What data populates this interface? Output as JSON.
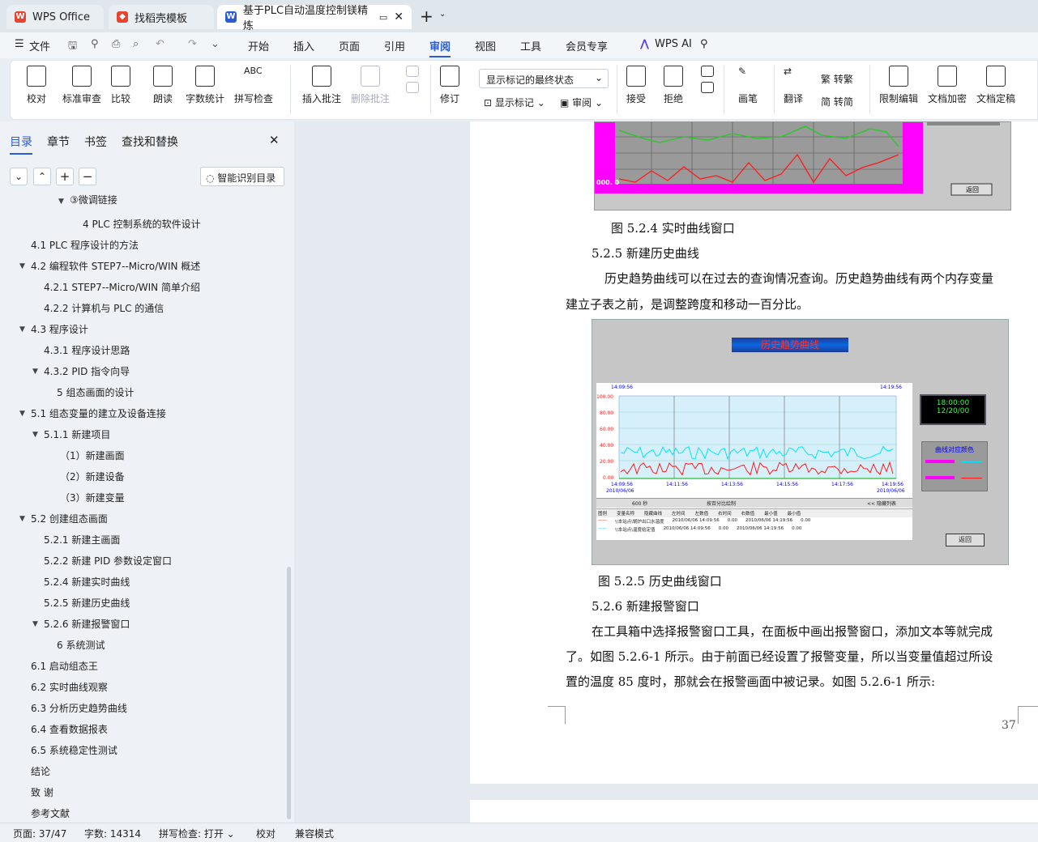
{
  "tabs": [
    {
      "label": "WPS Office",
      "logo_color": "#e8432e"
    },
    {
      "label": "找稻壳模板",
      "logo_color": "#e8432e"
    },
    {
      "label": "基于PLC自动温度控制镁精炼",
      "logo_color": "#2a5bd7"
    }
  ],
  "menu": {
    "file": "文件",
    "items": [
      "开始",
      "插入",
      "页面",
      "引用",
      "审阅",
      "视图",
      "工具",
      "会员专享"
    ],
    "active": "审阅",
    "ai": "WPS AI"
  },
  "ribbon": {
    "proofread": "校对",
    "standard_review": "标准审查",
    "compare": "比较",
    "read_aloud": "朗读",
    "word_count": "字数统计",
    "spell_check": "拼写检查",
    "insert_comment": "插入批注",
    "delete_comment": "删除批注",
    "track_changes": "修订",
    "markup_select": "显示标记的最终状态",
    "show_markup": "显示标记",
    "review": "审阅",
    "accept": "接受",
    "reject": "拒绝",
    "pen": "画笔",
    "translate": "翻译",
    "to_traditional": "转繁",
    "to_simplified": "转简",
    "restrict_edit": "限制编辑",
    "doc_encrypt": "文档加密",
    "doc_finalize": "文档定稿"
  },
  "sidebar": {
    "tabs": [
      "目录",
      "章节",
      "书签",
      "查找和替换"
    ],
    "smart_btn": "智能识别目录",
    "items": [
      {
        "t": "③微调链接"
      },
      {
        "t": "4   PLC 控制系统的软件设计"
      },
      {
        "t": "4.1   PLC 程序设计的方法"
      },
      {
        "t": "4.2   编程软件 STEP7--Micro/WIN  概述"
      },
      {
        "t": "4.2.1   STEP7--Micro/WIN  简单介绍"
      },
      {
        "t": "4.2.2   计算机与 PLC 的通信"
      },
      {
        "t": "4.3   程序设计"
      },
      {
        "t": "4.3.1   程序设计思路"
      },
      {
        "t": "4.3.2   PID 指令向导"
      },
      {
        "t": "5   组态画面的设计"
      },
      {
        "t": "5.1   组态变量的建立及设备连接"
      },
      {
        "t": "5.1.1   新建项目"
      },
      {
        "t": "（1）新建画面"
      },
      {
        "t": "（2）新建设备"
      },
      {
        "t": "（3）新建变量"
      },
      {
        "t": "5.2   创建组态画面"
      },
      {
        "t": "5.2.1   新建主画面"
      },
      {
        "t": "5.2.2  新建 PID 参数设定窗口"
      },
      {
        "t": "5.2.4  新建实时曲线"
      },
      {
        "t": "5.2.5  新建历史曲线"
      },
      {
        "t": "5.2.6  新建报警窗口"
      },
      {
        "t": "6   系统测试"
      },
      {
        "t": "6.1   启动组态王"
      },
      {
        "t": "6.2   实时曲线观察"
      },
      {
        "t": "6.3   分析历史趋势曲线"
      },
      {
        "t": "6.4   查看数据报表"
      },
      {
        "t": "6.5  系统稳定性测试"
      },
      {
        "t": "结论"
      },
      {
        "t": "致   谢"
      },
      {
        "t": "参考文献"
      }
    ]
  },
  "doc": {
    "fig1_caption": "图 5.2.4 实时曲线窗口",
    "sec1": "5.2.5  新建历史曲线",
    "para1_l1": "历史趋势曲线可以在过去的查询情况查询。历史趋势曲线有两个内存变量",
    "para1_l2": "建立子表之前，是调整跨度和移动一百分比。",
    "fig2_title": "历史趋势曲线",
    "fig2_caption": "图 5.2.5  历史曲线窗口",
    "sec2": "5.2.6   新建报警窗口",
    "para2_l1": "在工具箱中选择报警窗口工具，在面板中画出报警窗口，添加文本等就完成",
    "para2_l2": "了。如图 5.2.6-1 所示。由于前面已经设置了报警变量，所以当变量值超过所设",
    "para2_l3": "置的温度 85 度时，那就会在报警画面中被记录。如图 5.2.6-1 所示:",
    "page_num": "37",
    "fig1_return": "返回",
    "fig1_zero": "000. 0",
    "fig2_return": "返回",
    "clock_time": "18:00:00",
    "clock_date": "12/20/00",
    "legend_title": "曲线对应颜色",
    "span": "600 秒",
    "pct": "按百分比绘制",
    "hide_list": "<< 隐藏列表",
    "y_ticks": [
      "100.00",
      "80.00",
      "60.00",
      "40.00",
      "20.00",
      "0.00"
    ],
    "x_ticks": [
      "14:09:56",
      "14:11:56",
      "14:13:56",
      "14:15:56",
      "14:17:56",
      "14:19:56"
    ],
    "x_date": "2010/06/06",
    "table_headers": [
      "图例",
      "变量名称",
      "隐藏曲线",
      "左时间",
      "左数值",
      "右时间",
      "右数值",
      "最小值",
      "最小值"
    ],
    "table_rows": [
      [
        "\\\\本站点\\锅炉出口水温度",
        "2010/06/06 14:09:56",
        "0.00",
        "2010/06/06 14:19:56",
        "0.00"
      ],
      [
        "\\\\本站点\\温度给定值",
        "2010/06/06 14:09:56",
        "0.00",
        "2010/06/06 14:19:56",
        "0.00"
      ]
    ]
  },
  "status": {
    "page": "页面: 37/47",
    "words": "字数: 14314",
    "spell": "拼写检查: 打开",
    "proof": "校对",
    "compat": "兼容模式"
  },
  "colors": {
    "accent": "#2a5bd7",
    "magenta": "#ff00ff",
    "cyan": "#00e5ff",
    "red": "#ff1a1a",
    "green": "#22cc22"
  }
}
